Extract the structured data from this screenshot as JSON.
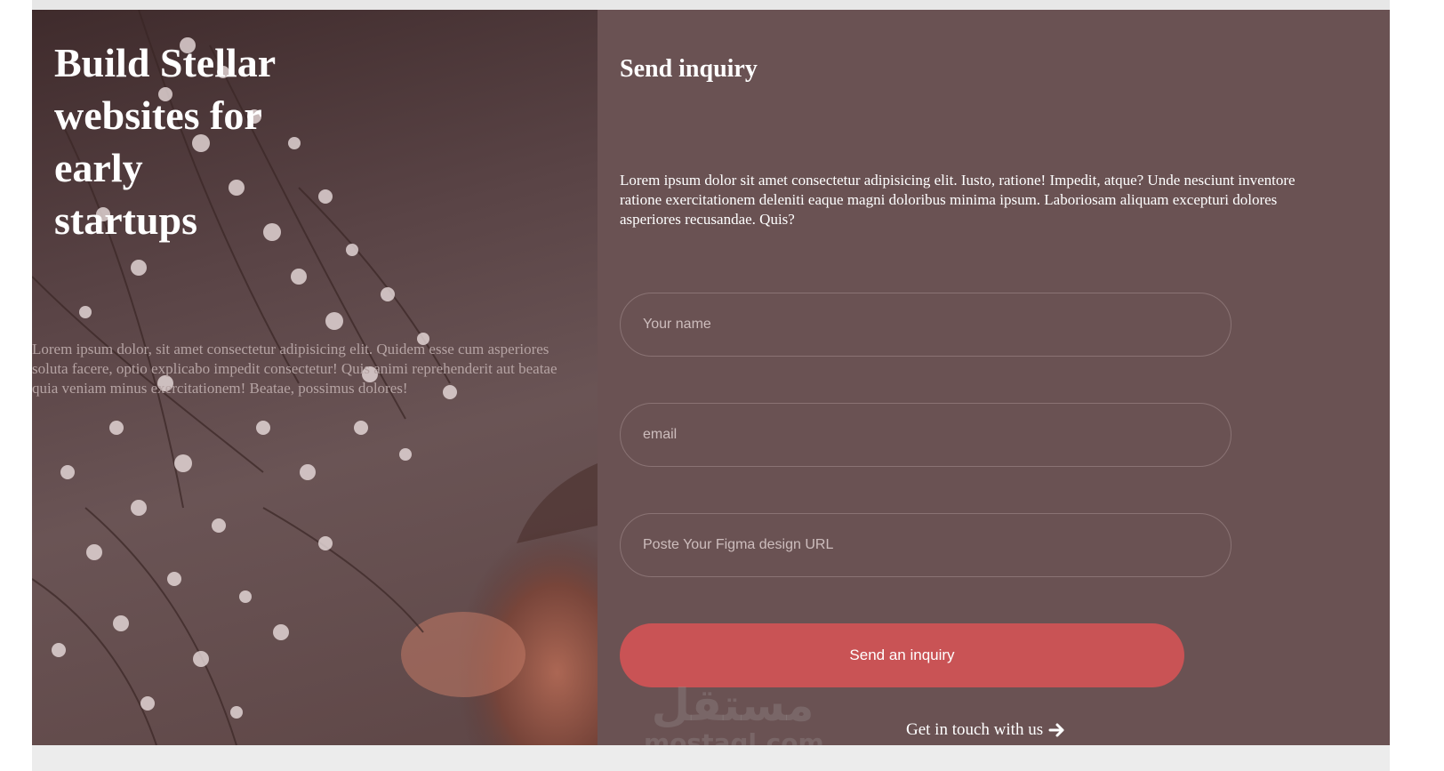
{
  "hero": {
    "title": "Build Stellar websites for early startups",
    "text": "Lorem ipsum dolor, sit amet consectetur adipisicing elit. Quidem esse cum asperiores soluta facere, optio explicabo impedit consectetur! Quis animi reprehenderit aut beatae quia veniam minus exercitationem! Beatae, possimus dolores!",
    "image_icon": "flowers-portrait-photo"
  },
  "form": {
    "title": "Send inquiry",
    "text": "Lorem ipsum dolor sit amet consectetur adipisicing elit. Iusto, ratione! Impedit, atque? Unde nesciunt inventore ratione exercitationem deleniti eaque magni doloribus minima ipsum. Laboriosam aliquam excepturi dolores asperiores recusandae. Quis?",
    "name_placeholder": "Your name",
    "email_placeholder": "email",
    "url_placeholder": "Poste Your Figma design URL",
    "submit_label": "Send an inquiry",
    "contact_label": "Get in touch with us",
    "contact_icon": "arrow-right-icon"
  },
  "watermark": {
    "arabic": "مستقل",
    "latin": "mostaql.com"
  },
  "colors": {
    "panel_bg": "#6a5253",
    "button_bg": "#c95355",
    "field_border": "#8a7374",
    "hero_text": "#b5a3a3"
  }
}
